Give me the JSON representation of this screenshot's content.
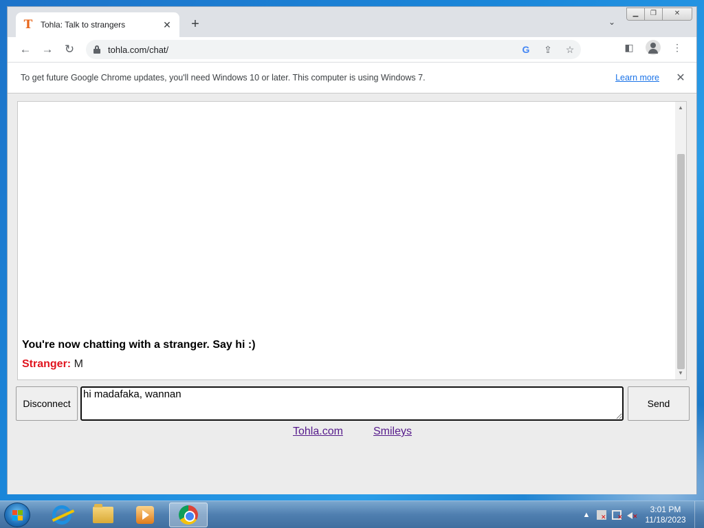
{
  "browser": {
    "tab": {
      "title": "Tohla: Talk to strangers",
      "favicon": "T"
    },
    "new_tab": "+",
    "url": "tohla.com/chat/",
    "infobar": {
      "message": "To get future Google Chrome updates, you'll need Windows 10 or later. This computer is using Windows 7.",
      "link": "Learn more"
    }
  },
  "chat": {
    "status": "You're now chatting with a stranger. Say hi :)",
    "messages": [
      {
        "sender": "Stranger:",
        "text": "M",
        "sender_color": "#e0141e"
      }
    ],
    "input_value": "hi madafaka, wannan",
    "disconnect_label": "Disconnect",
    "send_label": "Send"
  },
  "footer": {
    "links": [
      "Tohla.com",
      "Smileys"
    ]
  },
  "taskbar": {
    "clock_time": "3:01 PM",
    "clock_date": "11/18/2023"
  }
}
